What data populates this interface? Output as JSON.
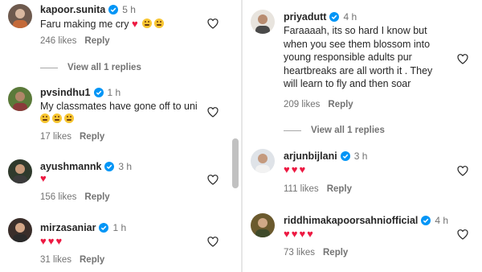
{
  "left": {
    "comments": [
      {
        "username": "kapoor.sunita",
        "verified": true,
        "time": "5 h",
        "text": "Faru making me cry",
        "likes": "246 likes",
        "reply": "Reply"
      },
      {
        "username": "pvsindhu1",
        "verified": true,
        "time": "1 h",
        "text": "My classmates have gone off to uni",
        "likes": "17 likes",
        "reply": "Reply"
      },
      {
        "username": "ayushmannk",
        "verified": true,
        "time": "3 h",
        "likes": "156 likes",
        "reply": "Reply"
      },
      {
        "username": "mirzasaniar",
        "verified": true,
        "time": "1 h",
        "likes": "31 likes",
        "reply": "Reply"
      }
    ],
    "view_replies": "View all 1 replies"
  },
  "right": {
    "comments": [
      {
        "username": "priyadutt",
        "verified": true,
        "time": "4 h",
        "text_lines": [
          "Faraaaah, its so hard I know but",
          "when you see them blossom into",
          "young responsible adults pur",
          "heartbreaks are all worth it . They",
          "will learn to fly and then soar"
        ],
        "likes": "209 likes",
        "reply": "Reply"
      },
      {
        "username": "arjunbijlani",
        "verified": true,
        "time": "3 h",
        "likes": "111 likes",
        "reply": "Reply"
      },
      {
        "username": "riddhimakapoorsahniofficial",
        "verified": true,
        "time": "4 h",
        "likes": "73 likes",
        "reply": "Reply"
      }
    ],
    "view_replies": "View all 1 replies"
  },
  "emojis": {
    "heart": "♥",
    "laugh_faces": "🤣"
  },
  "colors": {
    "verified": "#0095f6",
    "heart_emoji": "#ed1942",
    "muted": "#737373"
  },
  "icons": {
    "like": "heart-outline-icon",
    "verified": "verified-badge-icon"
  }
}
